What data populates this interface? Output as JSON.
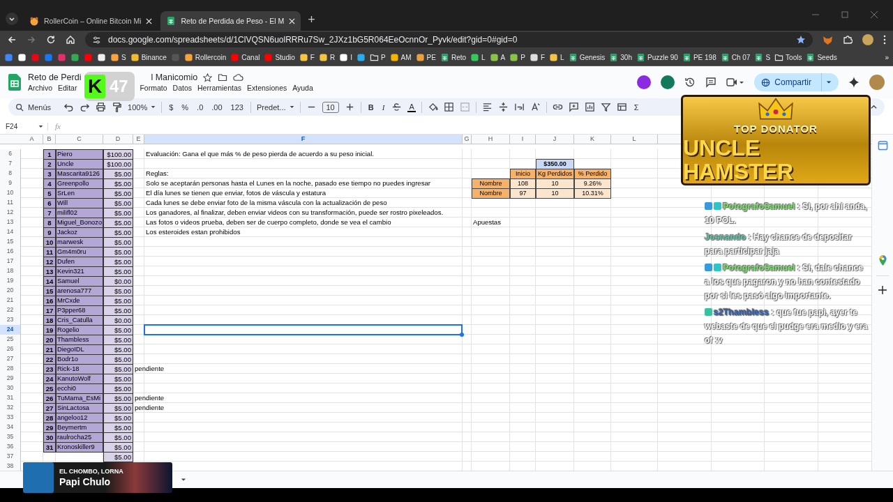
{
  "browser": {
    "tabs": [
      {
        "title": "RollerCoin – Online Bitcoin Mi",
        "kind": "hamster",
        "selected": false
      },
      {
        "title": "Reto de Perdida de Peso - El M",
        "kind": "sheets",
        "selected": true
      }
    ],
    "new_tab": "+",
    "url": "docs.google.com/spreadsheets/d/1ClVQSN6uolRRRu7Sw_2JXz1bG5R064EeOcnnOr_Pyvk/edit?gid=0#gid=0",
    "bookmarks": [
      {
        "kind": "site",
        "color": "#4285f4"
      },
      {
        "kind": "site",
        "color": "#ffffff"
      },
      {
        "kind": "site",
        "color": "#e50914"
      },
      {
        "kind": "site",
        "color": "#1877f2"
      },
      {
        "kind": "site",
        "color": "#e1306c"
      },
      {
        "kind": "site",
        "color": "#34a853"
      },
      {
        "kind": "site",
        "color": "#ff0000"
      },
      {
        "kind": "site",
        "color": "#eeeeee"
      },
      {
        "kind": "site",
        "color": "#f4a340",
        "label": "S"
      },
      {
        "kind": "site",
        "color": "#f3ba2f",
        "label": "Binance"
      },
      {
        "kind": "site",
        "color": "#555555"
      },
      {
        "kind": "site",
        "color": "#f4a340",
        "label": "Rollercoin"
      },
      {
        "kind": "site",
        "color": "#ff0000",
        "label": "Canal"
      },
      {
        "kind": "site",
        "color": "#ff0000",
        "label": "Studio"
      },
      {
        "kind": "site",
        "color": "#f6c445",
        "label": "F"
      },
      {
        "kind": "site",
        "color": "#f6c445",
        "label": "R"
      },
      {
        "kind": "site",
        "color": "#ffffff",
        "label": "I"
      },
      {
        "kind": "site",
        "color": "#2aabee"
      },
      {
        "kind": "folder",
        "label": "P"
      },
      {
        "kind": "site",
        "color": "#f5b400",
        "label": "AM"
      },
      {
        "kind": "site",
        "color": "#e8a040",
        "label": "PE"
      },
      {
        "kind": "sheets",
        "label": "Reto"
      },
      {
        "kind": "site",
        "color": "#34c759",
        "label": "L"
      },
      {
        "kind": "site",
        "color": "#8bc34a",
        "label": "A"
      },
      {
        "kind": "site",
        "color": "#8bc34a",
        "label": "P"
      },
      {
        "kind": "site",
        "color": "#dddddd",
        "label": "F"
      },
      {
        "kind": "site",
        "color": "#f6c445",
        "label": "L"
      },
      {
        "kind": "sheets",
        "label": "Genesis"
      },
      {
        "kind": "sheets",
        "label": "30h"
      },
      {
        "kind": "sheets",
        "label": "Puzzle 90"
      },
      {
        "kind": "sheets",
        "label": "PE 198"
      },
      {
        "kind": "sheets",
        "label": "Ch 07"
      },
      {
        "kind": "sheets",
        "label": "S"
      },
      {
        "kind": "folder",
        "label": "Tools"
      },
      {
        "kind": "sheets",
        "label": "Seeds"
      }
    ],
    "more_bookmarks": "»"
  },
  "doc": {
    "title_parts": [
      "Reto de Perdi",
      "l Manicomio"
    ],
    "menu_left": [
      "Archivo",
      "Editar"
    ],
    "menu_right": [
      "Formato",
      "Datos",
      "Herramientas",
      "Extensiones",
      "Ayuda"
    ],
    "share": "Compartir"
  },
  "toolbar": [
    {
      "kind": "search",
      "label": "Menús"
    },
    {
      "kind": "undo"
    },
    {
      "kind": "redo"
    },
    {
      "kind": "print"
    },
    {
      "kind": "paint"
    },
    {
      "kind": "dropdown",
      "label": "100%"
    },
    {
      "kind": "sep"
    },
    {
      "kind": "text",
      "label": "$"
    },
    {
      "kind": "text",
      "label": "%"
    },
    {
      "kind": "text",
      "label": ".0"
    },
    {
      "kind": "text",
      "label": ".00"
    },
    {
      "kind": "text",
      "label": "123"
    },
    {
      "kind": "sep"
    },
    {
      "kind": "dropdown",
      "label": "Predet..."
    },
    {
      "kind": "sep"
    },
    {
      "kind": "minus"
    },
    {
      "kind": "field",
      "label": "10"
    },
    {
      "kind": "plus"
    },
    {
      "kind": "sep"
    },
    {
      "kind": "bold",
      "label": "B"
    },
    {
      "kind": "italic",
      "label": "I"
    },
    {
      "kind": "strike"
    },
    {
      "kind": "underline",
      "label": "A"
    },
    {
      "kind": "sep"
    },
    {
      "kind": "fill"
    },
    {
      "kind": "borders"
    },
    {
      "kind": "merge"
    },
    {
      "kind": "sep"
    },
    {
      "kind": "align"
    },
    {
      "kind": "valign"
    },
    {
      "kind": "wrap"
    },
    {
      "kind": "rotate"
    },
    {
      "kind": "sep"
    },
    {
      "kind": "link"
    },
    {
      "kind": "comment"
    },
    {
      "kind": "chart"
    },
    {
      "kind": "filter"
    },
    {
      "kind": "table"
    },
    {
      "kind": "text",
      "label": "Σ"
    }
  ],
  "formula_bar": {
    "cell": "F24",
    "fx": "fx"
  },
  "sheet": {
    "columns": [
      {
        "label": "A",
        "selected": false
      },
      {
        "label": "B",
        "selected": false
      },
      {
        "label": "C",
        "selected": false
      },
      {
        "label": "D",
        "selected": false
      },
      {
        "label": "E",
        "selected": false
      },
      {
        "label": "F",
        "selected": true
      },
      {
        "label": "G",
        "selected": false
      },
      {
        "label": "H",
        "selected": false
      },
      {
        "label": "I",
        "selected": false
      },
      {
        "label": "J",
        "selected": false
      },
      {
        "label": "K",
        "selected": false
      },
      {
        "label": "L",
        "selected": false
      }
    ],
    "rows": [
      {
        "label": "6",
        "selected": false,
        "entry": {
          "number": "1",
          "name": "Piero",
          "amount": "$100.00"
        },
        "text": "Evaluación: Gana el que más % de peso pierda de acuerdo a su peso inicial."
      },
      {
        "label": "7",
        "selected": false,
        "entry": {
          "number": "2",
          "name": "Uncle",
          "amount": "$100.00"
        }
      },
      {
        "label": "8",
        "selected": false,
        "entry": {
          "number": "3",
          "name": "Mascarita9126",
          "amount": "$5.00"
        },
        "text": "Reglas:"
      },
      {
        "label": "9",
        "selected": false,
        "entry": {
          "number": "4",
          "name": "Greenpollo",
          "amount": "$5.00"
        },
        "text": "Solo se aceptarán personas hasta el Lunes en la noche, pasado ese tiempo no puedes ingresar"
      },
      {
        "label": "10",
        "selected": false,
        "entry": {
          "number": "5",
          "name": "SrLen",
          "amount": "$5.00"
        },
        "text": "El día lunes se tienen que enviar, fotos de váscula y estatura"
      },
      {
        "label": "11",
        "selected": false,
        "entry": {
          "number": "6",
          "name": "Will",
          "amount": "$5.00"
        },
        "text": "Cada lunes se debe enviar foto de la misma váscula con la actualización de peso"
      },
      {
        "label": "12",
        "selected": false,
        "entry": {
          "number": "7",
          "name": "milifl02",
          "amount": "$5.00"
        },
        "text": "Los ganadores, al finalizar, deben enviar videos con su transformación, puede ser rostro pixeleados."
      },
      {
        "label": "13",
        "selected": false,
        "entry": {
          "number": "8",
          "name": "Miguel_Bonozo",
          "amount": "$5.00"
        },
        "text": "Las fotos o videos prueba, deben ser de cuerpo completo, donde se vea el cambio"
      },
      {
        "label": "14",
        "selected": false,
        "entry": {
          "number": "9",
          "name": "Jackoz",
          "amount": "$5.00"
        },
        "text": "Los esteroides estan prohibidos"
      },
      {
        "label": "15",
        "selected": false,
        "entry": {
          "number": "10",
          "name": "marwesk",
          "amount": "$5.00"
        }
      },
      {
        "label": "16",
        "selected": false,
        "entry": {
          "number": "11",
          "name": "Gm4m0ru",
          "amount": "$5.00"
        }
      },
      {
        "label": "17",
        "selected": false,
        "entry": {
          "number": "12",
          "name": "Dufen",
          "amount": "$5.00"
        }
      },
      {
        "label": "18",
        "selected": false,
        "entry": {
          "number": "13",
          "name": "Kevin321",
          "amount": "$5.00"
        }
      },
      {
        "label": "19",
        "selected": false,
        "entry": {
          "number": "14",
          "name": "Samuel",
          "amount": "$0.00"
        }
      },
      {
        "label": "20",
        "selected": false,
        "entry": {
          "number": "15",
          "name": "arenosa777",
          "amount": "$5.00"
        }
      },
      {
        "label": "21",
        "selected": false,
        "entry": {
          "number": "16",
          "name": "MrCxde",
          "amount": "$5.00"
        }
      },
      {
        "label": "22",
        "selected": false,
        "entry": {
          "number": "17",
          "name": "P3pper68",
          "amount": "$5.00"
        }
      },
      {
        "label": "23",
        "selected": false,
        "entry": {
          "number": "18",
          "name": "Cris_Catulla",
          "amount": "$0.00"
        }
      },
      {
        "label": "24",
        "selected": true,
        "entry": {
          "number": "19",
          "name": "Rogelio",
          "amount": "$5.00"
        }
      },
      {
        "label": "25",
        "selected": false,
        "entry": {
          "number": "20",
          "name": "Thambless",
          "amount": "$5.00"
        }
      },
      {
        "label": "26",
        "selected": false,
        "entry": {
          "number": "21",
          "name": "DiegoIDL",
          "amount": "$5.00"
        }
      },
      {
        "label": "27",
        "selected": false,
        "entry": {
          "number": "22",
          "name": "Bodr1o",
          "amount": "$5.00"
        }
      },
      {
        "label": "28",
        "selected": false,
        "entry": {
          "number": "23",
          "name": "Rick-18",
          "amount": "$5.00"
        },
        "note": "pendiente"
      },
      {
        "label": "29",
        "selected": false,
        "entry": {
          "number": "24",
          "name": "KanutoWolf",
          "amount": "$5.00"
        }
      },
      {
        "label": "30",
        "selected": false,
        "entry": {
          "number": "25",
          "name": "ecchi0",
          "amount": "$5.00"
        }
      },
      {
        "label": "31",
        "selected": false,
        "entry": {
          "number": "26",
          "name": "TuMama_EsMi",
          "amount": "$5.00"
        },
        "note": "pendiente"
      },
      {
        "label": "32",
        "selected": false,
        "entry": {
          "number": "27",
          "name": "SinLactosa",
          "amount": "$5.00"
        },
        "note": "pendiente"
      },
      {
        "label": "33",
        "selected": false,
        "entry": {
          "number": "28",
          "name": "angeloo12",
          "amount": "$5.00"
        }
      },
      {
        "label": "34",
        "selected": false,
        "entry": {
          "number": "29",
          "name": "Beymertm",
          "amount": "$5.00"
        }
      },
      {
        "label": "35",
        "selected": false,
        "entry": {
          "number": "30",
          "name": "raulrocha25",
          "amount": "$5.00"
        }
      },
      {
        "label": "36",
        "selected": false,
        "entry": {
          "number": "31",
          "name": "Kronoskiller9",
          "amount": "$5.00"
        }
      },
      {
        "label": "37",
        "selected": false,
        "entry": {
          "amount": "$5.00"
        }
      },
      {
        "label": "38",
        "selected": false
      }
    ],
    "pot": "$350.00",
    "weight_table": {
      "headers": [
        "Inicio",
        "Kg Perdidos",
        "% Perdido"
      ],
      "rows": [
        {
          "label": "Nombre",
          "values": [
            "108",
            "10",
            "9.26%"
          ]
        },
        {
          "label": "Nombre",
          "values": [
            "97",
            "10",
            "10.31%"
          ]
        }
      ]
    },
    "bets_label": "Apuestas"
  },
  "overlays": {
    "badge": {
      "letter": "K",
      "count": "47"
    },
    "donator": {
      "kicker": "TOP DONATOR",
      "name": "UNCLE HAMSTER"
    },
    "chat": [
      {
        "user": "PotografoSamuel",
        "color": "#7be36a",
        "badges": [
          {
            "color": "#3a9ad9"
          },
          {
            "color": "#2fc4c8"
          }
        ],
        "separator": ":",
        "text": "Sí, por ahí anda, 10 POL."
      },
      {
        "user": "Josnando",
        "color": "#5fc4a8",
        "separator": ":",
        "text": "Hay chance de depositar para participar jaja"
      },
      {
        "user": "PotografoSamuel",
        "color": "#7be36a",
        "badges": [
          {
            "color": "#3a9ad9"
          },
          {
            "color": "#2fc4c8"
          }
        ],
        "separator": ":",
        "text": "Sí, dale chance a los que pagaron y no han contestado por si les pasó algo importante."
      },
      {
        "user": "s2Thambless",
        "color": "#2f5fb0",
        "badges": [
          {
            "color": "#3cc0a0"
          }
        ],
        "separator": ":",
        "text": "que fue papi, ayer te webaste de que el pudge era medio y era of :v"
      }
    ],
    "now_playing": {
      "artist": "EL CHOMBO, LORNA",
      "song": "Papi Chulo"
    }
  }
}
